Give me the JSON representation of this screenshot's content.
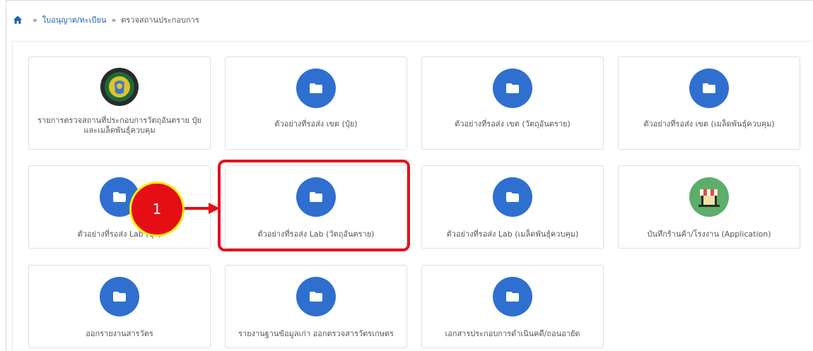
{
  "breadcrumb": {
    "home_icon": "home-icon",
    "separator": "»",
    "link": "ใบอนุญาต/ทะเบียน",
    "current": "ตรวจสถานประกอบการ"
  },
  "tiles": [
    {
      "label": "รายการตรวจสถานที่ประกอบการวัตถุอันตราย ปุ๋ย และเมล็ดพันธุ์ควบคุม",
      "icon": "department-emblem-icon"
    },
    {
      "label": "ตัวอย่างที่รอส่ง เขต (ปุ๋ย)",
      "icon": "folder-icon"
    },
    {
      "label": "ตัวอย่างที่รอส่ง เขต (วัตถุอันตราย)",
      "icon": "folder-icon"
    },
    {
      "label": "ตัวอย่างที่รอส่ง เขต (เมล็ดพันธุ์ควบคุม)",
      "icon": "folder-icon"
    },
    {
      "label": "ตัวอย่างที่รอส่ง Lab (ปุ๋ย)",
      "icon": "folder-icon"
    },
    {
      "label": "ตัวอย่างที่รอส่ง Lab (วัตถุอันตราย)",
      "icon": "folder-icon"
    },
    {
      "label": "ตัวอย่างที่รอส่ง Lab (เมล็ดพันธุ์ควบคุม)",
      "icon": "folder-icon"
    },
    {
      "label": "บันทึกร้านค้า/โรงงาน (Application)",
      "icon": "shop-icon"
    },
    {
      "label": "ออกรายงานสารวัตร",
      "icon": "folder-icon"
    },
    {
      "label": "รายงานฐานข้อมูลเก่า ออกตรวจสารวัตรเกษตร",
      "icon": "folder-icon"
    },
    {
      "label": "เอกสารประกอบการดำเนินคดี/ถอนอายัด",
      "icon": "folder-icon"
    }
  ],
  "annotation": {
    "step_number": "1",
    "highlight_color": "#e8101e",
    "badge_color": "#e50e14",
    "badge_border": "#ffee00"
  },
  "colors": {
    "folder": "#2f6fd0",
    "link": "#1f62b5"
  }
}
